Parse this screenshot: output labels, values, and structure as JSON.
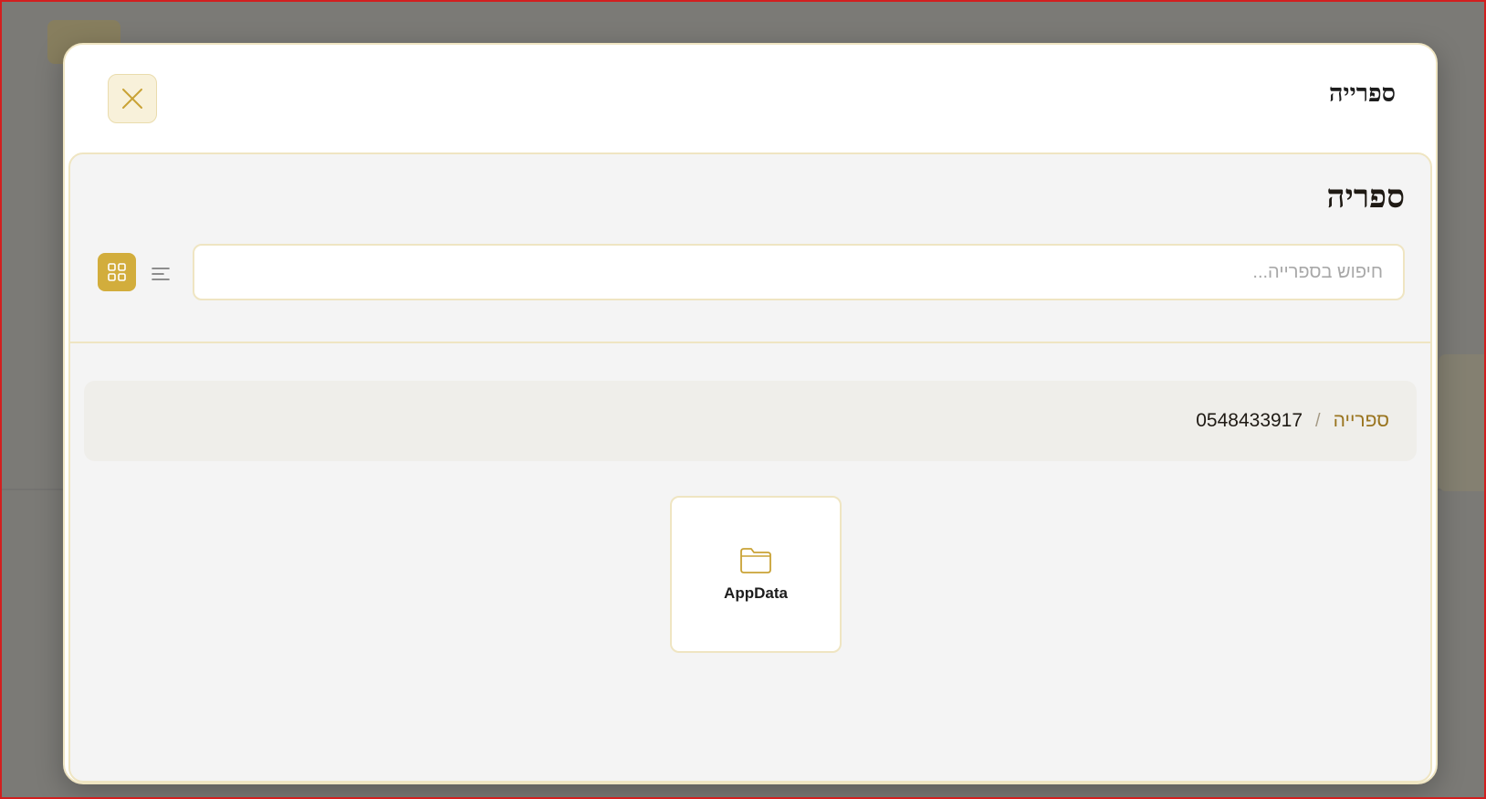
{
  "modal": {
    "title": "ספרייה",
    "close_icon": "close-icon"
  },
  "library": {
    "heading": "ספריה",
    "search_placeholder": "חיפוש בספרייה...",
    "search_value": "",
    "view_modes": {
      "list_icon": "list-view-icon",
      "grid_icon": "grid-view-icon",
      "active": "grid"
    }
  },
  "breadcrumb": {
    "root": "ספרייה",
    "separator": "/",
    "current": "0548433917"
  },
  "items": [
    {
      "type": "folder",
      "icon": "folder-icon",
      "name": "AppData"
    }
  ],
  "colors": {
    "accent": "#d2ad3c",
    "accent_light": "#f8f1da",
    "border": "#efe5c2",
    "breadcrumb_link": "#9a7520"
  }
}
